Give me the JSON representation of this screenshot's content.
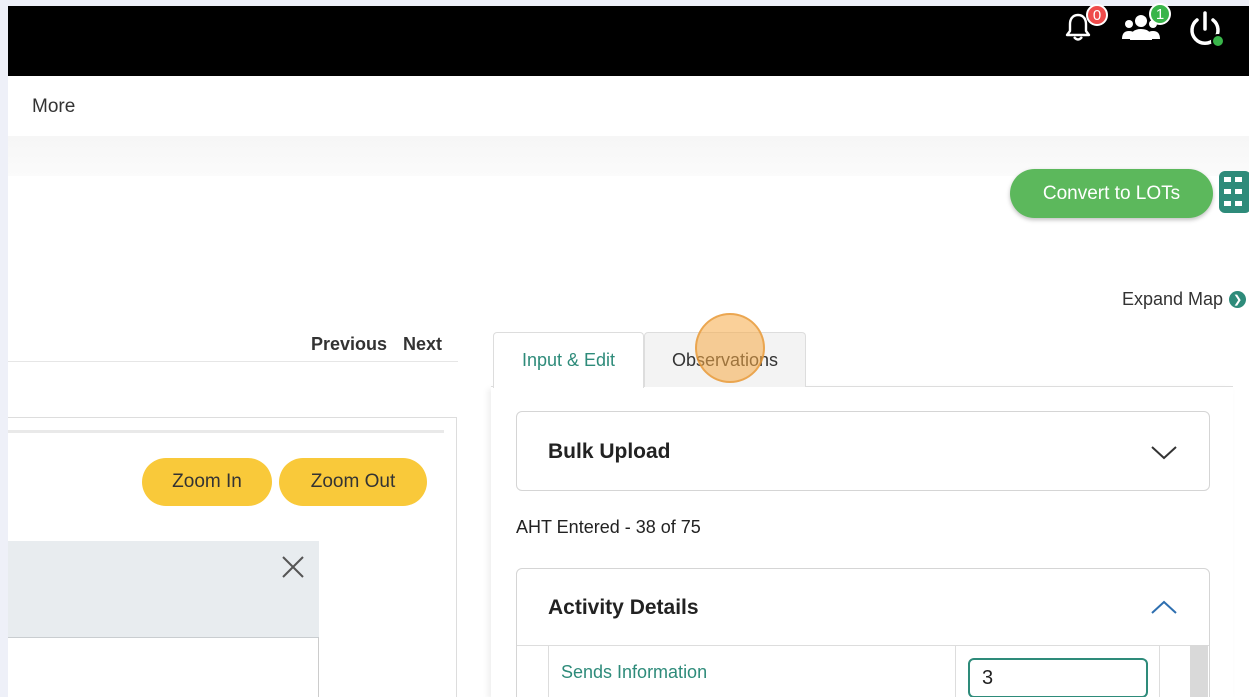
{
  "header": {
    "notifications_count": "0",
    "users_count": "1",
    "accent_color": "#2e8b7a"
  },
  "nav": {
    "more_label": "More"
  },
  "toolbar": {
    "convert_label": "Convert to LOTs",
    "expand_map_label": "Expand Map"
  },
  "pager": {
    "previous_label": "Previous",
    "next_label": "Next"
  },
  "viewer": {
    "zoom_in_label": "Zoom In",
    "zoom_out_label": "Zoom Out"
  },
  "tabs": [
    {
      "label": "Input & Edit",
      "active": true
    },
    {
      "label": "Observations",
      "active": false
    }
  ],
  "bulk_upload": {
    "title": "Bulk Upload"
  },
  "progress": {
    "text": "AHT Entered - 38 of 75"
  },
  "activity_details": {
    "title": "Activity Details",
    "rows": [
      {
        "label": "Sends Information",
        "value": "3"
      }
    ]
  }
}
